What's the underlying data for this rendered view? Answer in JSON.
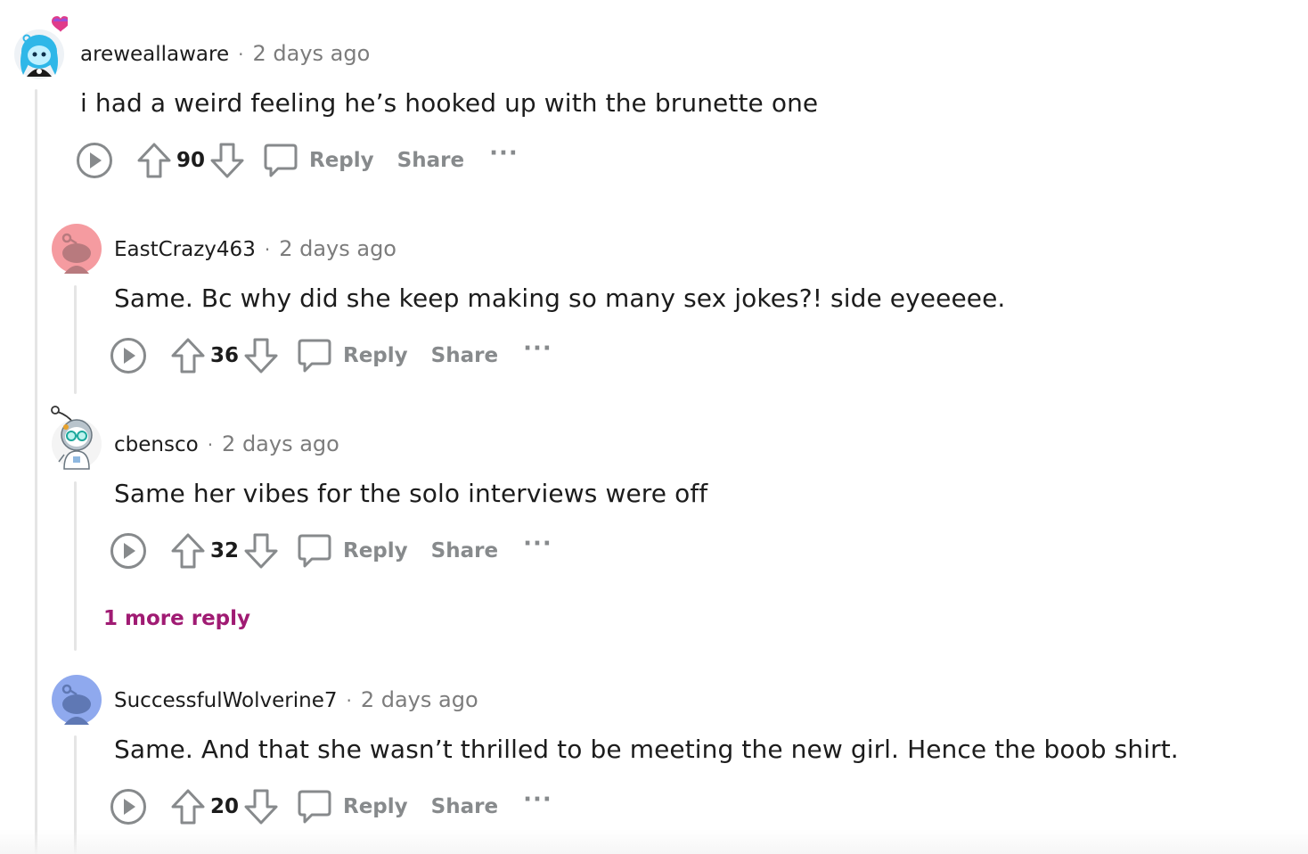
{
  "comments": [
    {
      "username": "areweallaware",
      "separator": "·",
      "time": "2 days ago",
      "body": "i had a weird feeling he’s hooked up with the brunette one",
      "votes": "90",
      "reply_label": "Reply",
      "share_label": "Share",
      "more_label": "···",
      "avatar_style": "snoo-blue-hair-with-heart"
    },
    {
      "username": "EastCrazy463",
      "separator": "·",
      "time": "2 days ago",
      "body": "Same. Bc why did she keep making so many sex jokes?! side eyeeeee.",
      "votes": "36",
      "reply_label": "Reply",
      "share_label": "Share",
      "more_label": "···",
      "avatar_color": "#f59ba0",
      "avatar_style": "default-snoo"
    },
    {
      "username": "cbensco",
      "separator": "·",
      "time": "2 days ago",
      "body": "Same her vibes for the solo interviews were off",
      "votes": "32",
      "reply_label": "Reply",
      "share_label": "Share",
      "more_label": "···",
      "avatar_style": "snoo-astronaut-glasses"
    },
    {
      "username": "SuccessfulWolverine7",
      "separator": "·",
      "time": "2 days ago",
      "body": "Same. And that she wasn’t thrilled to be meeting the new girl. Hence the boob shirt.",
      "votes": "20",
      "reply_label": "Reply",
      "share_label": "Share",
      "more_label": "···",
      "avatar_color": "#8fa9ee",
      "avatar_style": "default-snoo"
    }
  ],
  "more_replies_label": "1 more reply",
  "colors": {
    "text": "#1c1c1c",
    "muted": "#7c7c7c",
    "action": "#878a8c",
    "more_reply": "#a01b73",
    "thread_line": "#e5e5e5"
  },
  "icons": {
    "play": "play-circle-icon",
    "upvote": "upvote-arrow-icon",
    "downvote": "downvote-arrow-icon",
    "reply": "speech-bubble-icon"
  }
}
